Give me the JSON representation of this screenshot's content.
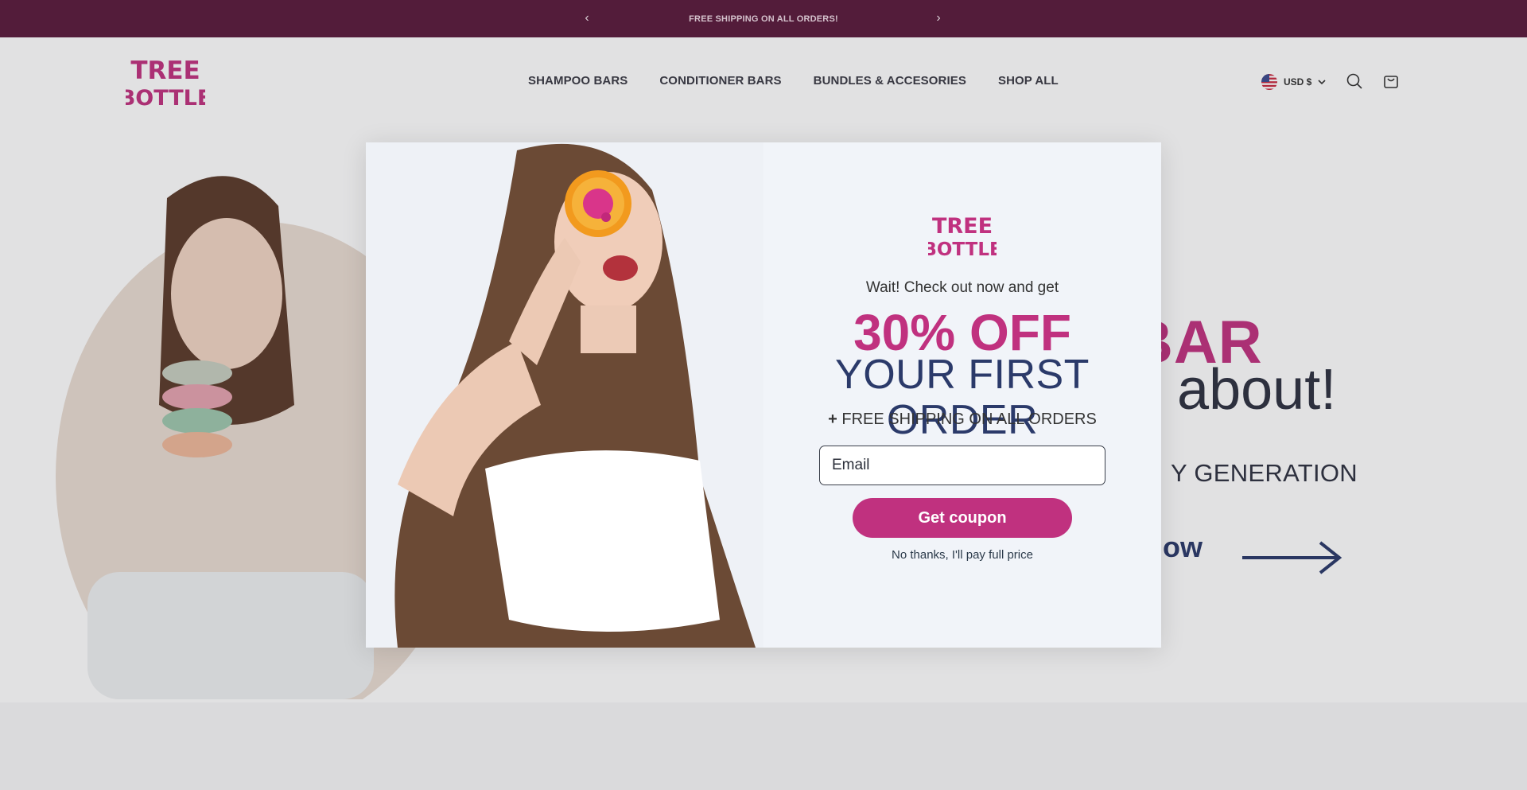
{
  "announcement": {
    "message": "FREE SHIPPING ON ALL ORDERS!",
    "prev_symbol": "‹",
    "next_symbol": "›"
  },
  "header": {
    "logo_line1": "TREE",
    "logo_line2": "BOTTLE",
    "nav": [
      "SHAMPOO BARS",
      "CONDITIONER BARS",
      "BUNDLES & ACCESORIES",
      "SHOP ALL"
    ],
    "currency": "USD $",
    "icons": [
      "us-flag-icon",
      "chevron-down-icon",
      "search-icon",
      "cart-icon"
    ]
  },
  "hero": {
    "title_partial": "BAR",
    "subtitle_partial": "g about!",
    "generation_partial": "Y GENERATION",
    "cta_partial": "now"
  },
  "modal": {
    "logo_line1": "TREE",
    "logo_line2": "BOTTLE",
    "intro": "Wait! Check out now and get",
    "discount": "30% OFF",
    "order": "YOUR FIRST ORDER",
    "shipping_plus": "+",
    "shipping": "FREE SHIPPING ON ALL ORDERS",
    "email_placeholder": "Email",
    "button_label": "Get coupon",
    "decline": "No thanks, I'll pay full price"
  },
  "colors": {
    "brand_magenta": "#c0317f",
    "announcement_bg": "#5a1a3c",
    "navy_text": "#2b3a6a",
    "modal_bg": "#f1f4f9"
  }
}
